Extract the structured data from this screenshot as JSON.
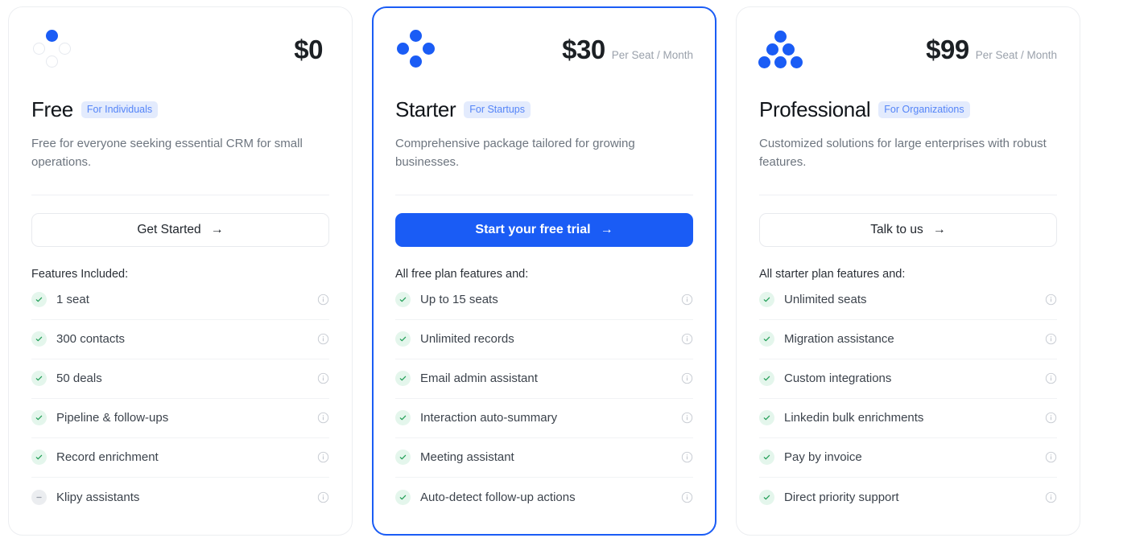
{
  "plans": [
    {
      "icon": "four-dot-diamond-outline-icon",
      "icon_variant": "diamond-one-filled",
      "price": "$0",
      "price_period": "",
      "name": "Free",
      "badge": "For Individuals",
      "description": "Free for everyone seeking essential CRM for small operations.",
      "cta_label": "Get Started",
      "cta_arrow": "→",
      "cta_style": "outline",
      "features_title": "Features Included:",
      "features": [
        {
          "label": "1 seat",
          "state": "included"
        },
        {
          "label": "300 contacts",
          "state": "included"
        },
        {
          "label": "50 deals",
          "state": "included"
        },
        {
          "label": "Pipeline & follow-ups",
          "state": "included"
        },
        {
          "label": "Record enrichment",
          "state": "included"
        },
        {
          "label": "Klipy assistants",
          "state": "excluded"
        }
      ]
    },
    {
      "icon": "four-dot-diamond-filled-icon",
      "icon_variant": "diamond-all-filled",
      "price": "$30",
      "price_period": "Per Seat / Month",
      "name": "Starter",
      "badge": "For Startups",
      "description": "Comprehensive package tailored for growing businesses.",
      "cta_label": "Start your free trial",
      "cta_arrow": "→",
      "cta_style": "solid",
      "features_title": "All free plan features and:",
      "features": [
        {
          "label": "Up to 15 seats",
          "state": "included"
        },
        {
          "label": "Unlimited records",
          "state": "included"
        },
        {
          "label": "Email admin assistant",
          "state": "included"
        },
        {
          "label": "Interaction auto-summary",
          "state": "included"
        },
        {
          "label": "Meeting assistant",
          "state": "included"
        },
        {
          "label": "Auto-detect follow-up actions",
          "state": "included"
        }
      ]
    },
    {
      "icon": "six-dot-pyramid-icon",
      "icon_variant": "pyramid",
      "price": "$99",
      "price_period": "Per Seat / Month",
      "name": "Professional",
      "badge": "For Organizations",
      "description": "Customized solutions for large enterprises with robust features.",
      "cta_label": "Talk to us",
      "cta_arrow": "→",
      "cta_style": "outline",
      "features_title": "All starter plan features and:",
      "features": [
        {
          "label": "Unlimited seats",
          "state": "included"
        },
        {
          "label": "Migration assistance",
          "state": "included"
        },
        {
          "label": "Custom integrations",
          "state": "included"
        },
        {
          "label": "Linkedin bulk enrichments",
          "state": "included"
        },
        {
          "label": "Pay by invoice",
          "state": "included"
        },
        {
          "label": "Direct priority support",
          "state": "included"
        }
      ]
    }
  ],
  "icons": {
    "check": "check-icon",
    "minus": "minus-icon",
    "info": "info-icon"
  },
  "colors": {
    "accent": "#1a5cf5",
    "badge_bg": "#e3ebfd",
    "badge_text": "#5585f8",
    "check_bg": "#e4f6ec",
    "check_fg": "#1f9d55",
    "minus_bg": "#ebedf0",
    "minus_fg": "#9aa1ab",
    "card_border": "#eceef1",
    "featured_border": "#1a5cf5",
    "text_primary": "#11151a",
    "text_muted": "#6d757f"
  }
}
